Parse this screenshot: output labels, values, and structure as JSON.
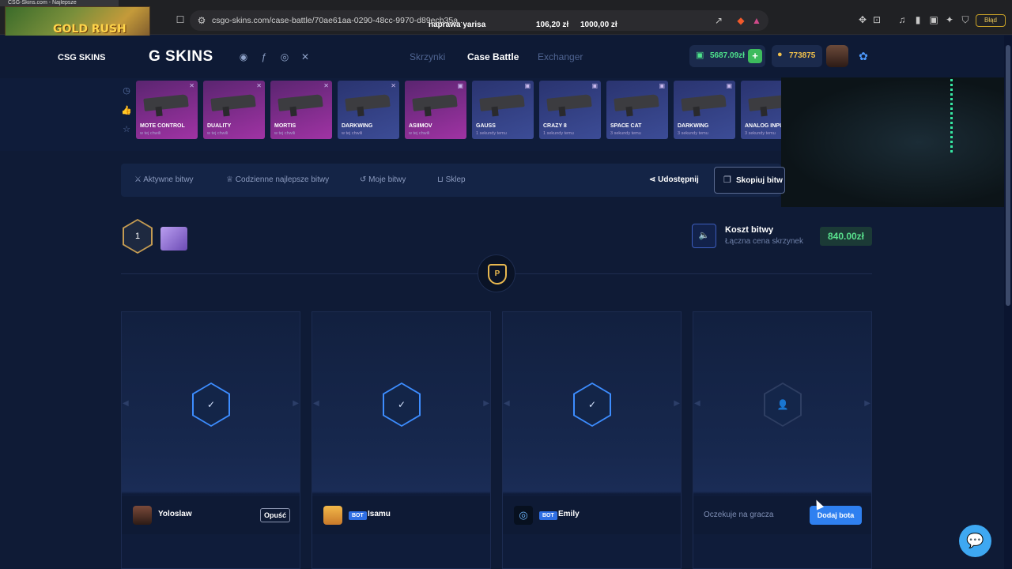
{
  "browser": {
    "tab_title": "CSG-Skins.com - Najlepsze",
    "url": "csgo-skins.com/case-battle/70ae61aa-0290-48cc-9970-d89ecb35a...",
    "error_badge": "Błąd"
  },
  "overlay": {
    "goal_label": "naprawa yarisa",
    "goal_current": "106,20 zł",
    "goal_target": "1000,00 zł",
    "logo_text": "GOLD RUSH"
  },
  "header": {
    "brand_small": "CSG SKINS",
    "brand": "G SKINS",
    "nav": [
      "Skrzynki",
      "Case Battle",
      "Exchanger"
    ],
    "active_nav": "Case Battle",
    "balance": "5687.09zł",
    "coins": "773875",
    "accent_color": "#3d8dff",
    "balance_color": "#4ee38c"
  },
  "live_drops": [
    {
      "name": "MOTE CONTROL",
      "sub": "w tej chwili"
    },
    {
      "name": "DUALITY",
      "sub": "w tej chwili"
    },
    {
      "name": "MORTIS",
      "sub": "w tej chwili"
    },
    {
      "name": "DARKWING",
      "sub": "w tej chwili"
    },
    {
      "name": "ASIIMOV",
      "sub": "w tej chwili"
    },
    {
      "name": "GAUSS",
      "sub": "1 sekundy temu"
    },
    {
      "name": "CRAZY 8",
      "sub": "1 sekundy temu"
    },
    {
      "name": "SPACE CAT",
      "sub": "3 sekundy temu"
    },
    {
      "name": "DARKWING",
      "sub": "3 sekundy temu"
    },
    {
      "name": "ANALOG INPUT",
      "sub": "3 sekundy temu"
    }
  ],
  "battle_menu": {
    "items": [
      "Aktywne bitwy",
      "Codzienne najlepsze bitwy",
      "Moje bitwy",
      "Sklep"
    ],
    "share": "Udostępnij",
    "copy": "Skopiuj bitw"
  },
  "battle": {
    "round": "1",
    "cost_title": "Koszt bitwy",
    "cost_sub": "Łączna cena skrzynek",
    "cost_value": "840.00zł"
  },
  "players": [
    {
      "name": "Yoloslaw",
      "bot": false,
      "action": "Opuść"
    },
    {
      "name": "Isamu",
      "bot": true,
      "bot_label": "BOT"
    },
    {
      "name": "Emily",
      "bot": true,
      "bot_label": "BOT"
    },
    {
      "waiting": "Oczekuje na gracza",
      "action": "Dodaj bota"
    }
  ]
}
